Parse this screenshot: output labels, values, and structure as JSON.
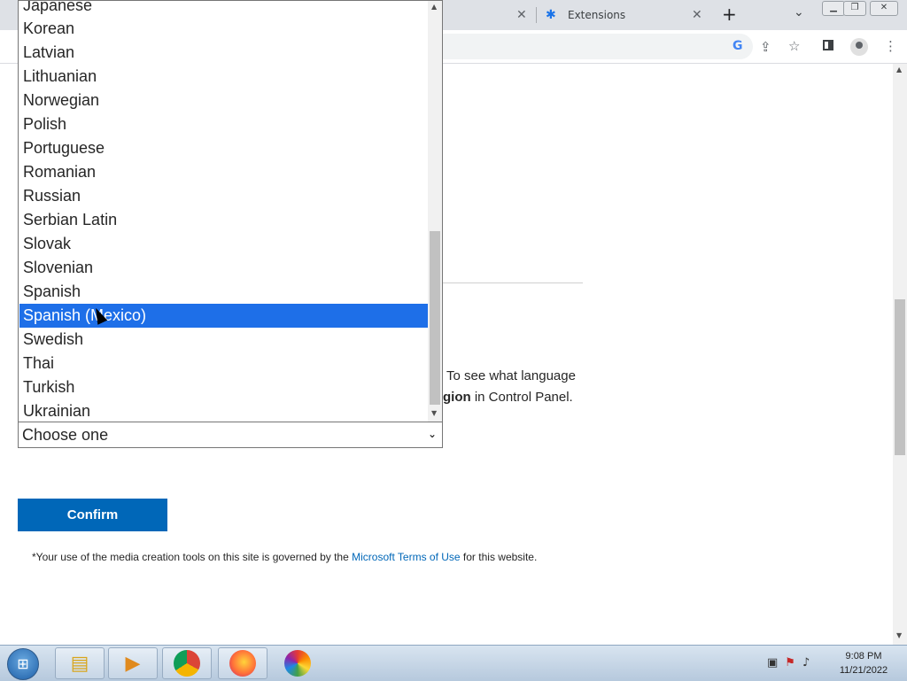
{
  "browser": {
    "tabs": [
      {
        "label": ""
      },
      {
        "label": "Extensions",
        "icon": "puzzle-icon"
      }
    ],
    "new_tab": "+",
    "toolbar_icons": [
      "google-icon",
      "share-icon",
      "star-icon",
      "sidepanel-icon",
      "profile-icon",
      "menu-icon"
    ]
  },
  "page": {
    "help_line1": "To see what language",
    "help_line2_bold": "gion",
    "help_line2_rest": " in Control Panel.",
    "select": {
      "value": "Choose one"
    },
    "confirm_label": "Confirm",
    "terms_prefix": "*Your use of the media creation tools on this site is governed by the ",
    "terms_link": "Microsoft Terms of Use",
    "terms_suffix": " for this website."
  },
  "dropdown": {
    "options": [
      "Japanese",
      "Korean",
      "Latvian",
      "Lithuanian",
      "Norwegian",
      "Polish",
      "Portuguese",
      "Romanian",
      "Russian",
      "Serbian Latin",
      "Slovak",
      "Slovenian",
      "Spanish",
      "Spanish (Mexico)",
      "Swedish",
      "Thai",
      "Turkish",
      "Ukrainian"
    ],
    "selected": "Spanish (Mexico)"
  },
  "taskbar": {
    "apps": [
      "windows-explorer",
      "media-player",
      "chrome",
      "firefox",
      "color-app"
    ],
    "time": "9:08 PM",
    "date": "11/21/2022"
  },
  "colors": {
    "accent": "#0067b8",
    "selection": "#1e6fe8"
  }
}
